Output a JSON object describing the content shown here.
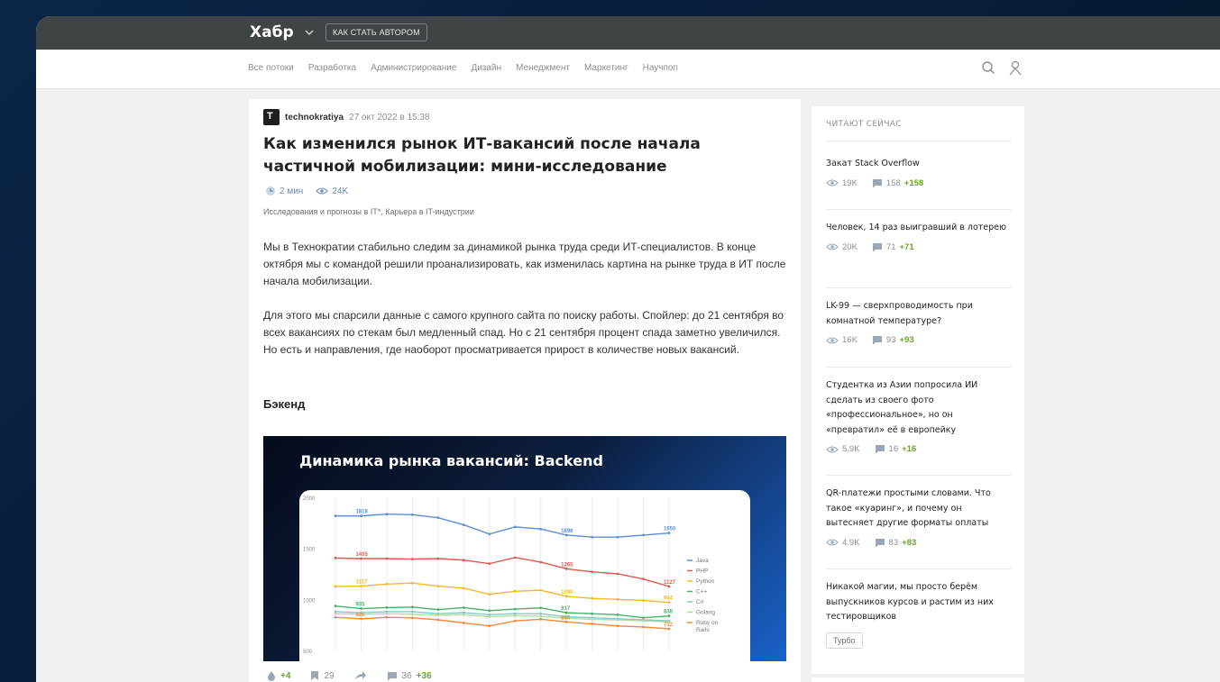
{
  "header": {
    "logo": "Хабр",
    "cta_label": "КАК СТАТЬ АВТОРОМ"
  },
  "nav": {
    "links": [
      "Все потоки",
      "Разработка",
      "Администрирование",
      "Дизайн",
      "Менеджмент",
      "Маркетинг",
      "Научпоп"
    ]
  },
  "article": {
    "author": "technokratiya",
    "date": "27 окт 2022 в 15:38",
    "title": "Как изменился рынок ИТ-вакансий после начала частичной мобилизации: мини-исследование",
    "read_time": "2 мин",
    "views": "24K",
    "hubs": "Исследования и прогнозы в IT*, Карьера в IT-индустрии",
    "paragraph1": "Мы в Технократии стабильно следим за динамикой рынка труда среди ИТ-специалистов. В конце октября мы с командой решили проанализировать, как изменилась картина на рынке труда в ИТ после начала мобилизации.",
    "paragraph2": "Для этого мы спарсили данные с самого крупного сайта по поиску работы. Спойлер: до 21 сентября во всех вакансиях по стекам был медленный спад. Но с 21 сентября процент спада заметно увеличился. Но есть и направления, где наоборот просматривается прирост в количестве новых вакансий.",
    "section_heading": "Бэкенд",
    "stats": {
      "votes": "+4",
      "bookmarks": "29",
      "comments": "36",
      "comments_new": "+36"
    }
  },
  "chart_data": {
    "type": "line",
    "title": "Динамика рынка вакансий: Backend",
    "ylim": [
      500,
      2000
    ],
    "yticks": [
      "2000",
      "1500",
      "1000",
      "500"
    ],
    "point_count": 14,
    "series": [
      {
        "name": "Java",
        "color": "#5b8fd9",
        "values": [
          1818,
          1818,
          1835,
          1830,
          1800,
          1730,
          1640,
          1710,
          1690,
          1630,
          1610,
          1610,
          1630,
          1650
        ],
        "labels": [
          {
            "i": 1,
            "text": "1818"
          },
          {
            "i": 9,
            "text": "1696"
          },
          {
            "i": 13,
            "text": "1650"
          }
        ]
      },
      {
        "name": "PHP",
        "color": "#e05a4e",
        "values": [
          1405,
          1400,
          1400,
          1395,
          1400,
          1385,
          1350,
          1410,
          1365,
          1300,
          1270,
          1250,
          1200,
          1127
        ],
        "labels": [
          {
            "i": 1,
            "text": "1405"
          },
          {
            "i": 9,
            "text": "1365"
          },
          {
            "i": 13,
            "text": "1127"
          }
        ]
      },
      {
        "name": "Python",
        "color": "#f3b731",
        "values": [
          1127,
          1130,
          1150,
          1160,
          1130,
          1110,
          1050,
          1080,
          1090,
          1030,
          1010,
          1000,
          990,
          970
        ],
        "labels": [
          {
            "i": 1,
            "text": "1127"
          },
          {
            "i": 9,
            "text": "1090"
          },
          {
            "i": 13,
            "text": "964"
          }
        ]
      },
      {
        "name": "C++",
        "color": "#4caf6a",
        "values": [
          935,
          910,
          920,
          925,
          900,
          920,
          890,
          905,
          917,
          870,
          860,
          850,
          820,
          838
        ],
        "labels": [
          {
            "i": 1,
            "text": "935"
          },
          {
            "i": 9,
            "text": "917"
          },
          {
            "i": 13,
            "text": "838"
          }
        ]
      },
      {
        "name": "C#",
        "color": "#80cbc4",
        "values": [
          880,
          870,
          880,
          880,
          860,
          870,
          850,
          860,
          860,
          830,
          820,
          810,
          800,
          790
        ],
        "labels": []
      },
      {
        "name": "Golang",
        "color": "#b3d9a5",
        "values": [
          860,
          855,
          860,
          855,
          845,
          850,
          830,
          840,
          835,
          815,
          805,
          800,
          790,
          780
        ],
        "labels": []
      },
      {
        "name": "Ruby on Rails",
        "color": "#f08a3c",
        "values": [
          825,
          810,
          825,
          820,
          800,
          770,
          740,
          790,
          806,
          780,
          760,
          740,
          730,
          712
        ],
        "labels": [
          {
            "i": 1,
            "text": "825"
          },
          {
            "i": 9,
            "text": "806"
          },
          {
            "i": 13,
            "text": "712"
          }
        ]
      }
    ]
  },
  "sidebar": {
    "heading": "ЧИТАЮТ СЕЙЧАС",
    "posts": [
      {
        "title": "Закат Stack Overflow",
        "views": "19K",
        "comments": "158",
        "comments_new": "+158"
      },
      {
        "title": "Человек, 14 раз выигравший в лотерею",
        "views": "20K",
        "comments": "71",
        "comments_new": "+71"
      },
      {
        "title": "LK-99 — сверхпроводимость при комнатной температуре?",
        "views": "16K",
        "comments": "93",
        "comments_new": "+93"
      },
      {
        "title": "Студентка из Азии попросила ИИ сделать из своего фото «профессиональное», но он «превратил» её в европейку",
        "views": "5.9K",
        "comments": "16",
        "comments_new": "+16"
      },
      {
        "title": "QR-платежи простыми словами. Что такое «куаринг», и почему он вытесняет другие форматы оплаты",
        "views": "4.9K",
        "comments": "83",
        "comments_new": "+83"
      },
      {
        "title": "Никакой магии, мы просто берём выпускников курсов и растим из них тестировщиков",
        "tag": "Турбо"
      }
    ]
  }
}
